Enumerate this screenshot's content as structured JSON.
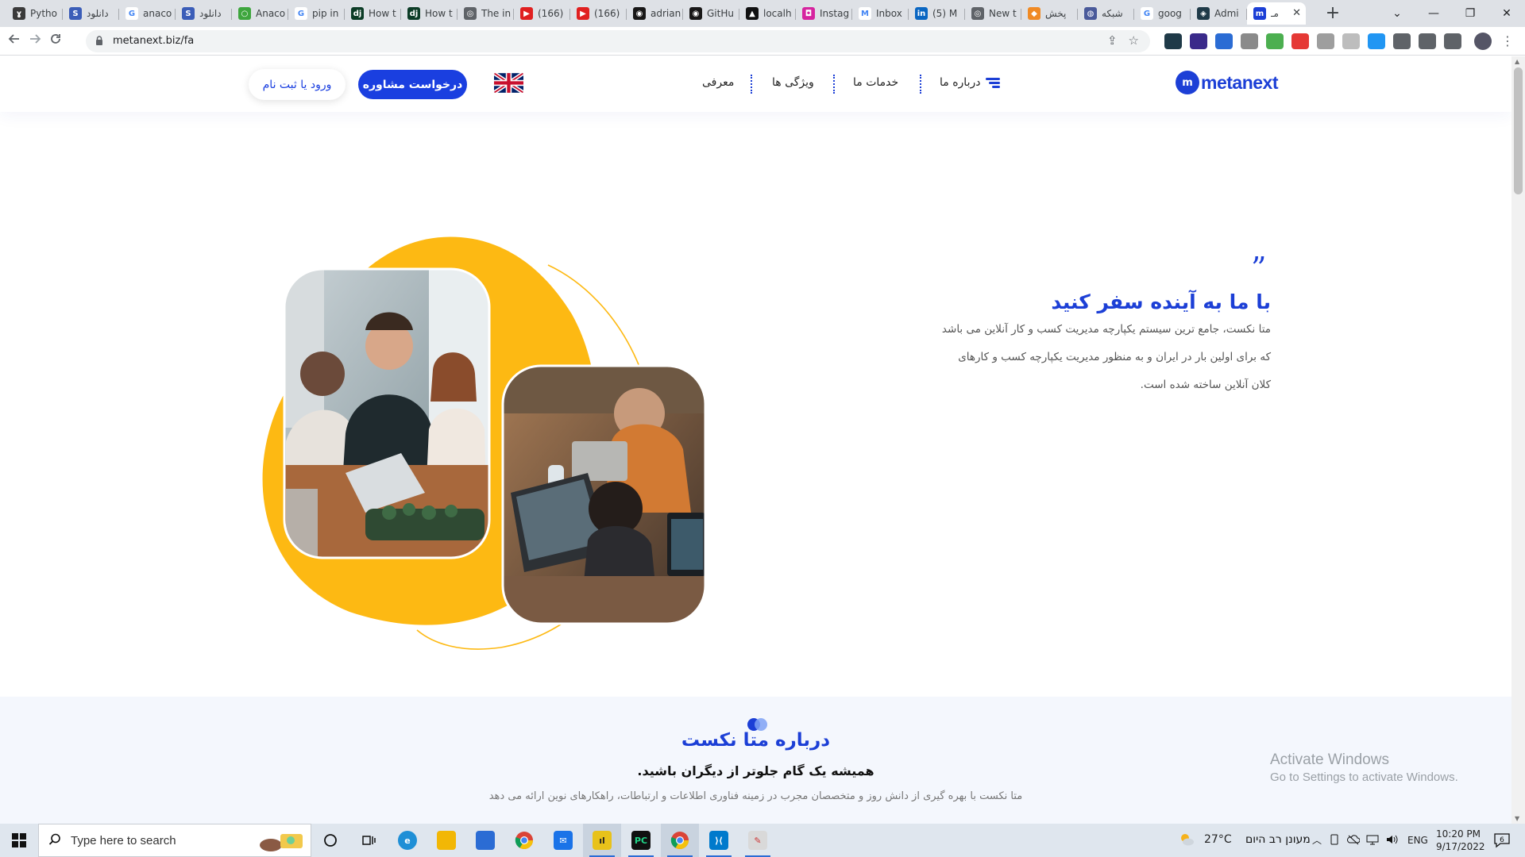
{
  "browser": {
    "tabs": [
      {
        "label": "Pytho",
        "color": "#3a3a3a",
        "glyph": "ɣ"
      },
      {
        "label": "دانلود",
        "color": "#3b5db8",
        "glyph": "S"
      },
      {
        "label": "anaco",
        "color": "#ffffff",
        "glyph": "G"
      },
      {
        "label": "دانلود",
        "color": "#3b5db8",
        "glyph": "S"
      },
      {
        "label": "Anaco",
        "color": "#3ea63e",
        "glyph": "○"
      },
      {
        "label": "pip in",
        "color": "#ffffff",
        "glyph": "G"
      },
      {
        "label": "How t",
        "color": "#0c3c26",
        "glyph": "dj"
      },
      {
        "label": "How t",
        "color": "#0c3c26",
        "glyph": "dj"
      },
      {
        "label": "The in",
        "color": "#5f6368",
        "glyph": "◎"
      },
      {
        "label": "(166)",
        "color": "#e02020",
        "glyph": "▶"
      },
      {
        "label": "(166)",
        "color": "#e02020",
        "glyph": "▶"
      },
      {
        "label": "adrian",
        "color": "#181717",
        "glyph": "◉"
      },
      {
        "label": "GitHu",
        "color": "#181717",
        "glyph": "◉"
      },
      {
        "label": "localh",
        "color": "#111111",
        "glyph": "▲"
      },
      {
        "label": "Instag",
        "color": "#d6249f",
        "glyph": "◘"
      },
      {
        "label": "Inbox",
        "color": "#ffffff",
        "glyph": "M"
      },
      {
        "label": "(5) M",
        "color": "#0a66c2",
        "glyph": "in"
      },
      {
        "label": "New t",
        "color": "#5f6368",
        "glyph": "◎"
      },
      {
        "label": "پخش",
        "color": "#f08a24",
        "glyph": "◆"
      },
      {
        "label": "شبکه",
        "color": "#4a5a9a",
        "glyph": "◍"
      },
      {
        "label": "goog",
        "color": "#ffffff",
        "glyph": "G"
      },
      {
        "label": "Admi",
        "color": "#1f3a48",
        "glyph": "◈"
      },
      {
        "label": "مـ",
        "color": "#1c3fd6",
        "glyph": "m",
        "active": true
      }
    ],
    "url": "metanext.biz/fa",
    "window_controls": [
      "⌄",
      "—",
      "❐",
      "✕"
    ],
    "new_tab_glyph": "+"
  },
  "site": {
    "logo_text": "metanext",
    "logo_badge": "m",
    "nav": {
      "about": "درباره ما",
      "services": "خدمات ما",
      "features": "ویژگی ها",
      "intro": "معرفی"
    },
    "consult_button": "درخواست مشاوره",
    "login_button": "ورود یا ثبت نام",
    "language_flag": "uk-flag",
    "hero": {
      "quote_mark": "”",
      "title": "با ما به آینده سفر کنید",
      "text": "متا نکست، جامع ترین سیستم یکپارچه مدیریت کسب و کار آنلاین می باشد که برای اولین بار در ایران و به منظور مدیریت یکپارچه کسب و کارهای کلان آنلاین ساخته شده است."
    },
    "about": {
      "title": "درباره متا نکست",
      "subtitle": "همیشه یک گام جلوتر از دیگران باشید.",
      "peek_text": "متا نکست با بهره گیری از دانش روز و متخصصان مجرب در زمینه فناوری اطلاعات و ارتباطات، راهکارهای نوین ارائه می دهد"
    },
    "colors": {
      "brand": "#1c3fd6",
      "accent": "#fdb913",
      "button": "#1a3fe0"
    }
  },
  "os": {
    "activate_title": "Activate Windows",
    "activate_sub": "Go to Settings to activate Windows.",
    "search_placeholder": "Type here to search",
    "weather_temp": "27°C",
    "weather_text": "מעונן רב היום",
    "language": "ENG",
    "time": "10:20 PM",
    "date": "9/17/2022",
    "notification_count": "6"
  }
}
